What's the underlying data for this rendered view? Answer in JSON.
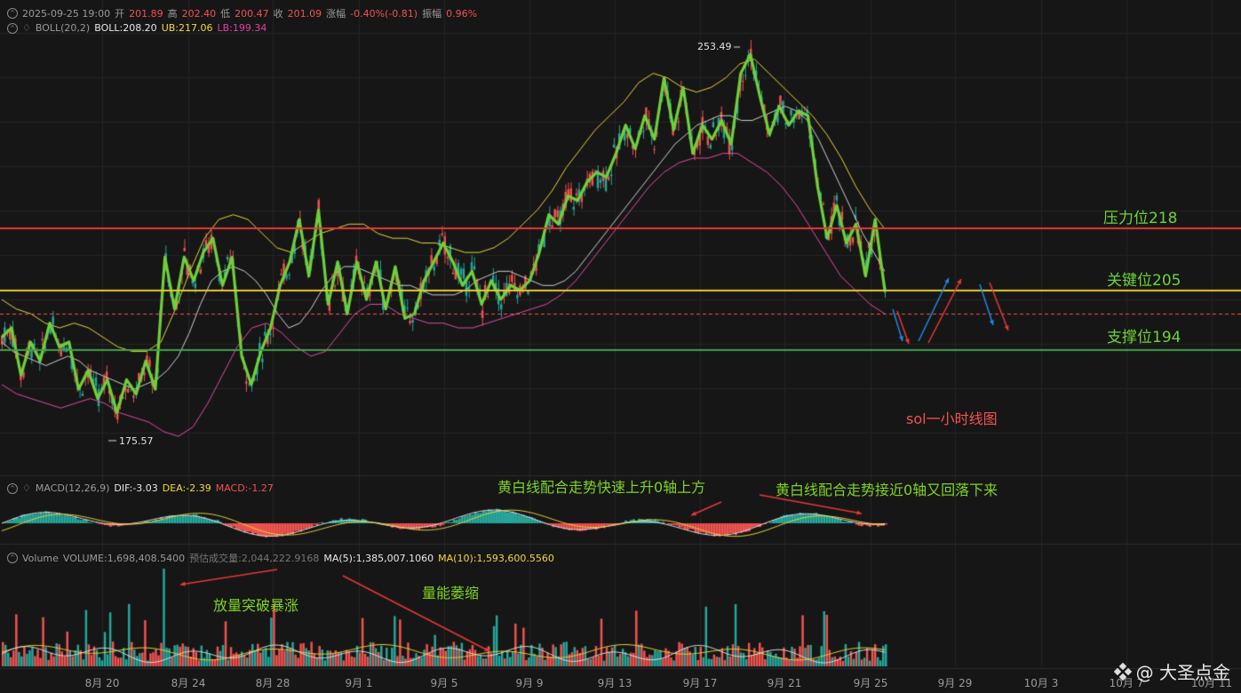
{
  "header": {
    "ohlc": {
      "date": "2025-09-25 19:00",
      "open_label": "开",
      "open": "201.89",
      "high_label": "高",
      "high": "202.40",
      "low_label": "低",
      "low": "200.47",
      "close_label": "收",
      "close": "201.09",
      "change_label": "涨幅",
      "change": "-0.40%(-0.81)",
      "amp_label": "振幅",
      "amp": "0.96%"
    },
    "boll": {
      "name": "BOLL(20,2)",
      "mid": "BOLL:208.20",
      "ub": "UB:217.06",
      "lb": "LB:199.34"
    }
  },
  "macd": {
    "name": "MACD(12,26,9)",
    "dif": "DIF:-3.03",
    "dea": "DEA:-2.39",
    "macd": "MACD:-1.27"
  },
  "volume": {
    "name": "Volume",
    "volume": "VOLUME:1,698,408.5400",
    "estimate": "预估成交量:2,044,222.9168",
    "ma5": "MA(5):1,385,007.1060",
    "ma10": "MA(10):1,593,600.5560"
  },
  "price_marks": {
    "high": "253.49",
    "low": "175.57"
  },
  "levels": {
    "resistance": {
      "label": "压力位218",
      "value": 218,
      "color": "#e53935"
    },
    "key": {
      "label": "关键位205",
      "value": 205,
      "color": "#e6c733"
    },
    "support": {
      "label": "支撑位194",
      "value": 194,
      "color": "#43a047"
    }
  },
  "annotations": {
    "chart_title": "sol一小时线图",
    "macd_note_1": "黄白线配合走势快速上升0轴上方",
    "macd_note_2": "黄白线配合走势接近0轴又回落下来",
    "vol_note_1": "放量突破暴涨",
    "vol_note_2": "量能萎缩"
  },
  "x_axis": {
    "labels": [
      "8月 20",
      "8月 24",
      "8月 28",
      "9月 1",
      "9月 5",
      "9月 9",
      "9月 13",
      "9月 17",
      "9月 21",
      "9月 25",
      "9月 29",
      "10月 3",
      "10月 7",
      "10月 11"
    ]
  },
  "watermark": {
    "text": "@ 大圣点金"
  },
  "chart_data": {
    "type": "line",
    "title": "",
    "xlabel": "",
    "ylabel": "",
    "ylim": [
      170,
      258
    ],
    "series": [
      {
        "name": "price-zigzag",
        "values": [
          194,
          196,
          186,
          193,
          189,
          197,
          192,
          193,
          183,
          187,
          181,
          185,
          178,
          185,
          182,
          189,
          183,
          211,
          200,
          211,
          206,
          212,
          215,
          205,
          211,
          190,
          184,
          191,
          196,
          205,
          210,
          219,
          207,
          221,
          201,
          210,
          199,
          210,
          202,
          210,
          200,
          209,
          198,
          199,
          206,
          210,
          214,
          210,
          205,
          208,
          201,
          206,
          202,
          205,
          204,
          206,
          212,
          220,
          218,
          224,
          223,
          227,
          229,
          228,
          233,
          239,
          234,
          241,
          236,
          249,
          238,
          247,
          233,
          239,
          236,
          240,
          235,
          250,
          254,
          245,
          237,
          243,
          239,
          242,
          241,
          226,
          215,
          222,
          214,
          218,
          207,
          219,
          204
        ]
      },
      {
        "name": "BOLL",
        "values": [
          193,
          191,
          190,
          189,
          188,
          189,
          190,
          189,
          187,
          186,
          185,
          184,
          183,
          184,
          185,
          187,
          190,
          195,
          201,
          206,
          208,
          209,
          208,
          206,
          203,
          199,
          196,
          197,
          200,
          204,
          207,
          209,
          209,
          208,
          207,
          206,
          205,
          205,
          204,
          203,
          203,
          203,
          204,
          206,
          207,
          208,
          208,
          207,
          206,
          205,
          205,
          206,
          208,
          211,
          214,
          217,
          220,
          223,
          226,
          229,
          232,
          235,
          237,
          239,
          240,
          241,
          241,
          240,
          240,
          241,
          242,
          243,
          242,
          240,
          236,
          231,
          226,
          221,
          216,
          212,
          208
        ]
      },
      {
        "name": "UB",
        "values": [
          202,
          200,
          199,
          197,
          196,
          197,
          196,
          194,
          192,
          191,
          191,
          193,
          200,
          208,
          215,
          219,
          220,
          219,
          216,
          213,
          212,
          214,
          216,
          217,
          218,
          218,
          216,
          215,
          215,
          214,
          214,
          213,
          212,
          212,
          213,
          215,
          218,
          221,
          225,
          230,
          234,
          238,
          241,
          244,
          248,
          250,
          249,
          247,
          246,
          247,
          249,
          252,
          253,
          250,
          247,
          244,
          241,
          237,
          232,
          226,
          221,
          217
        ]
      },
      {
        "name": "LB",
        "values": [
          184,
          182,
          181,
          180,
          179,
          180,
          181,
          180,
          178,
          177,
          176,
          174,
          173,
          175,
          180,
          186,
          192,
          196,
          197,
          195,
          192,
          190,
          191,
          195,
          199,
          201,
          201,
          199,
          198,
          197,
          197,
          196,
          196,
          197,
          198,
          199,
          200,
          201,
          203,
          206,
          210,
          214,
          218,
          222,
          226,
          229,
          231,
          232,
          232,
          233,
          233,
          231,
          229,
          226,
          222,
          217,
          212,
          207,
          204,
          201,
          199
        ]
      }
    ]
  }
}
